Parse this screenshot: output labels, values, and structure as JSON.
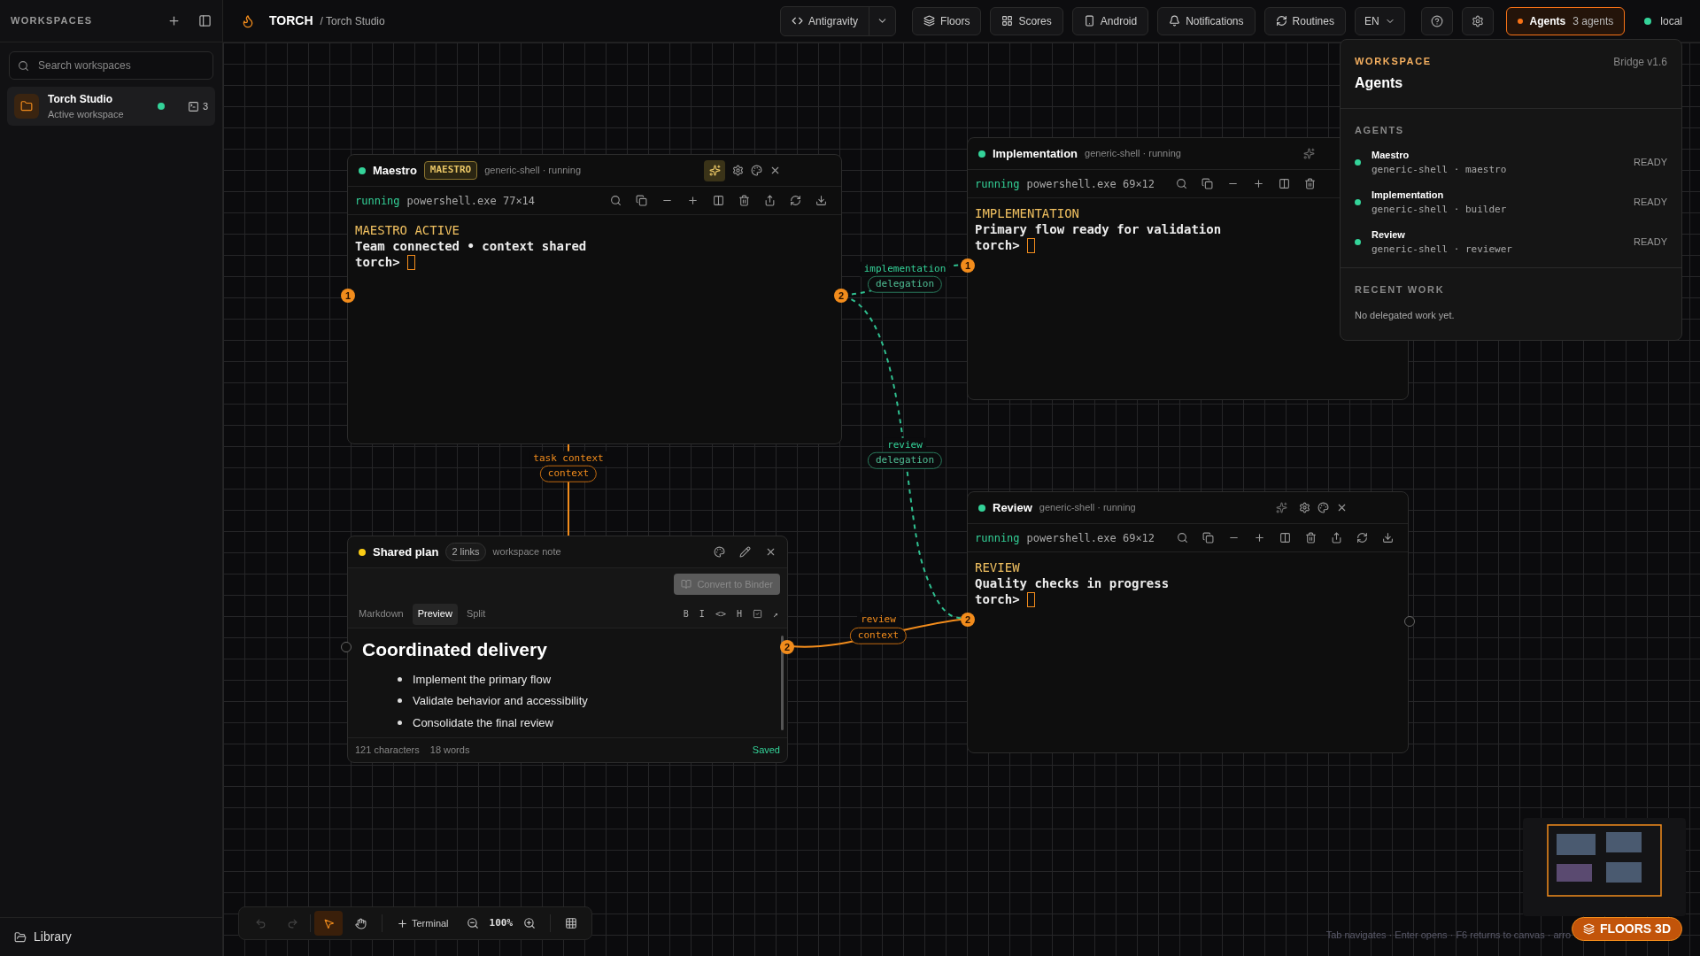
{
  "sidebar": {
    "title": "WORKSPACES",
    "search": {
      "placeholder": "Search workspaces"
    },
    "workspaces": [
      {
        "name": "Torch Studio",
        "subtitle": "Active workspace",
        "selected": true,
        "color": "#34d399",
        "terminal_count": "3"
      }
    ],
    "footer": {
      "label": "Library"
    }
  },
  "topbar": {
    "brand": "TORCH",
    "breadcrumb": "/ Torch Studio",
    "buttons": [
      {
        "kind": "code",
        "label": "Antigravity",
        "has_menu": true
      },
      {
        "kind": "layers",
        "label": "Floors",
        "has_menu": false
      },
      {
        "kind": "grid",
        "label": "Scores",
        "has_menu": false
      },
      {
        "kind": "phone",
        "label": "Android",
        "has_menu": false
      },
      {
        "kind": "bell",
        "label": "Notifications",
        "has_menu": false
      },
      {
        "kind": "refresh",
        "label": "Routines",
        "has_menu": false
      }
    ],
    "language": "EN",
    "agents_button": {
      "label": "Agents",
      "count": "3 agents",
      "active": true
    },
    "connection": {
      "label": "local",
      "color": "#34d399"
    }
  },
  "panels": [
    {
      "kind": "terminal",
      "title": "Maestro",
      "badge": "MAESTRO",
      "subtitle": "generic-shell · running",
      "color": "#34d399",
      "assistant_on": true,
      "partly_hidden": false,
      "status": "running",
      "process": "powershell.exe 77×14",
      "lines": [
        {
          "kind": "heading",
          "text": "MAESTRO ACTIVE"
        },
        {
          "kind": "output",
          "text": "Team connected • context shared"
        },
        {
          "kind": "prompt",
          "text": "torch>"
        }
      ],
      "ports": {
        "left": {
          "connected": true,
          "label": "1"
        },
        "right": {
          "connected": true,
          "label": "2"
        }
      }
    },
    {
      "kind": "terminal",
      "title": "Implementation",
      "subtitle": "generic-shell · running",
      "color": "#34d399",
      "assistant_on": false,
      "partly_hidden": true,
      "status": "running",
      "process": "powershell.exe 69×12",
      "lines": [
        {
          "kind": "heading",
          "text": "IMPLEMENTATION"
        },
        {
          "kind": "output",
          "text": "Primary flow ready for validation"
        },
        {
          "kind": "prompt",
          "text": "torch>"
        }
      ],
      "ports": {
        "left": {
          "connected": true,
          "label": "1"
        }
      }
    },
    {
      "kind": "terminal",
      "title": "Review",
      "subtitle": "generic-shell · running",
      "color": "#34d399",
      "assistant_on": false,
      "partly_hidden": false,
      "status": "running",
      "process": "powershell.exe 69×12",
      "lines": [
        {
          "kind": "heading",
          "text": "REVIEW"
        },
        {
          "kind": "output",
          "text": "Quality checks in progress"
        },
        {
          "kind": "prompt",
          "text": "torch>"
        }
      ],
      "ports": {
        "left": {
          "connected": true,
          "label": "2"
        },
        "right": {
          "connected": false
        }
      }
    },
    {
      "kind": "note",
      "title": "Shared plan",
      "links": "2 links",
      "subtitle": "workspace note",
      "color": "#facc15",
      "action": {
        "label": "Convert to Binder",
        "disabled": true
      },
      "tabs": [
        {
          "label": "Markdown",
          "selected": false
        },
        {
          "label": "Preview",
          "selected": true
        },
        {
          "label": "Split",
          "selected": false
        }
      ],
      "format_buttons": [
        {
          "kind": "text",
          "label": "B"
        },
        {
          "kind": "text",
          "label": "I"
        },
        {
          "kind": "text",
          "label": "<>"
        },
        {
          "kind": "text",
          "label": "H"
        },
        {
          "kind": "checklist"
        },
        {
          "kind": "text",
          "label": "↗"
        }
      ],
      "document": {
        "heading": "Coordinated delivery",
        "bullets": [
          "Implement the primary flow",
          "Validate behavior and accessibility",
          "Consolidate the final review"
        ]
      },
      "footer": {
        "characters": "121 characters",
        "words": "18 words",
        "status": "Saved"
      },
      "ports": {
        "left": {
          "connected": false
        },
        "right": {
          "connected": true,
          "label": "2"
        }
      }
    }
  ],
  "connections": [
    {
      "kind": "delegation",
      "label": "implementation",
      "tag": "delegation"
    },
    {
      "kind": "delegation",
      "label": "review",
      "tag": "delegation"
    },
    {
      "kind": "context",
      "label": "task context",
      "tag": "context"
    },
    {
      "kind": "context",
      "label": "review",
      "tag": "context"
    }
  ],
  "agents_popup": {
    "eyebrow": "WORKSPACE",
    "title": "Agents",
    "version": "Bridge v1.6",
    "section": "AGENTS",
    "agents": [
      {
        "name": "Maestro",
        "detail": "generic-shell · maestro",
        "status": "READY",
        "color": "#34d399"
      },
      {
        "name": "Implementation",
        "detail": "generic-shell · builder",
        "status": "READY",
        "color": "#34d399"
      },
      {
        "name": "Review",
        "detail": "generic-shell · reviewer",
        "status": "READY",
        "color": "#34d399"
      }
    ],
    "recent_title": "RECENT WORK",
    "recent_empty": "No delegated work yet."
  },
  "canvas_toolbar": {
    "history": [
      {
        "kind": "undo",
        "disabled": true
      },
      {
        "kind": "redo",
        "disabled": true
      }
    ],
    "tools": [
      {
        "kind": "select",
        "selected": true
      },
      {
        "kind": "pan",
        "selected": false
      }
    ],
    "add_label": "Terminal",
    "zoom": "100%"
  },
  "hint": "Tab navigates · Enter opens · F6 returns to canvas · arro",
  "floors_button": "FLOORS 3D"
}
